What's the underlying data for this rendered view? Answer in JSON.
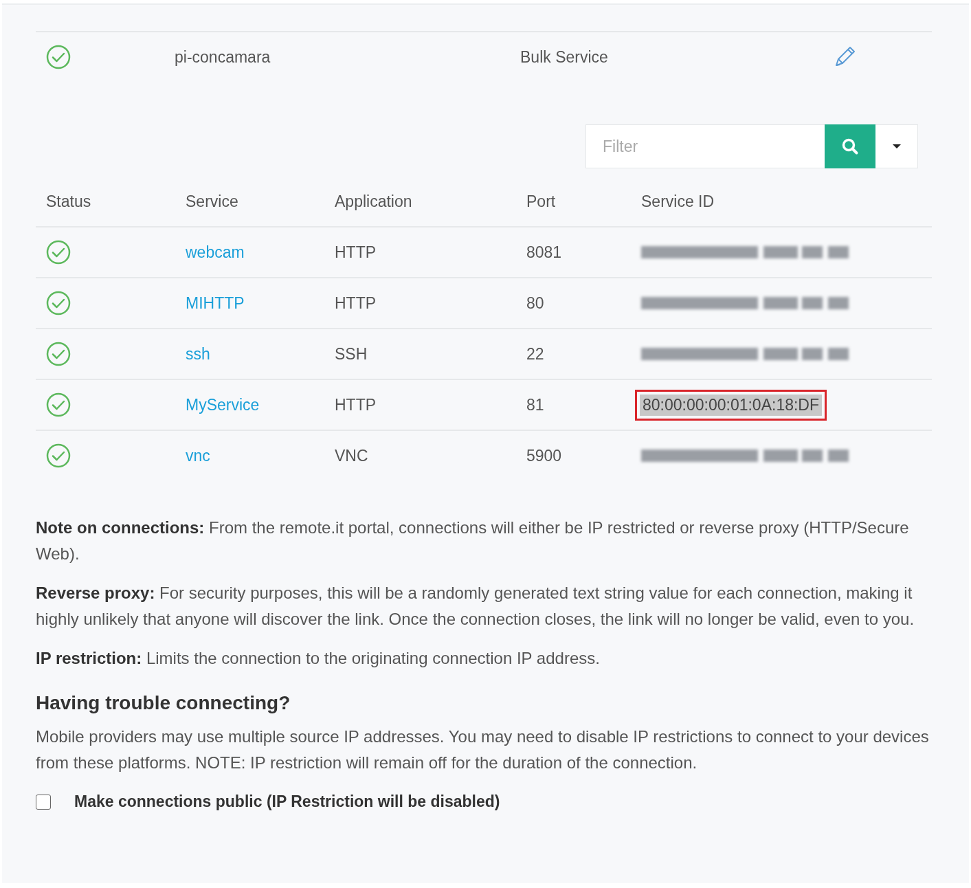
{
  "device": {
    "online": true,
    "name": "pi-concamara",
    "type": "Bulk Service"
  },
  "filter": {
    "placeholder": "Filter"
  },
  "table": {
    "columns": [
      "Status",
      "Service",
      "Application",
      "Port",
      "Service ID"
    ],
    "rows": [
      {
        "online": true,
        "service": "webcam",
        "application": "HTTP",
        "port": "8081",
        "redacted": true
      },
      {
        "online": true,
        "service": "MIHTTP",
        "application": "HTTP",
        "port": "80",
        "redacted": true
      },
      {
        "online": true,
        "service": "ssh",
        "application": "SSH",
        "port": "22",
        "redacted": true
      },
      {
        "online": true,
        "service": "MyService",
        "application": "HTTP",
        "port": "81",
        "service_id": "80:00:00:00:01:0A:18:DF",
        "highlighted": true
      },
      {
        "online": true,
        "service": "vnc",
        "application": "VNC",
        "port": "5900",
        "redacted": true
      }
    ]
  },
  "notes": [
    "**Note on connections:** From the remote.it portal, connections will either be IP restricted or reverse proxy (HTTP/Secure Web).",
    "**Reverse proxy:** For security purposes, this will be a randomly generated text string value for each connection, making it highly unlikely that anyone will discover the link. Once the connection closes, the link will no longer be valid, even to you.",
    "**IP restriction:** Limits the connection to the originating connection IP address."
  ],
  "trouble": {
    "heading": "Having trouble connecting?",
    "text": "Mobile providers may use multiple source IP addresses. You may need to disable IP restrictions to connect to your devices from these platforms. NOTE: IP restriction will remain off for the duration of the connection.",
    "checkbox": {
      "label": "Make connections public (IP Restriction will be disabled)",
      "checked": false
    }
  }
}
